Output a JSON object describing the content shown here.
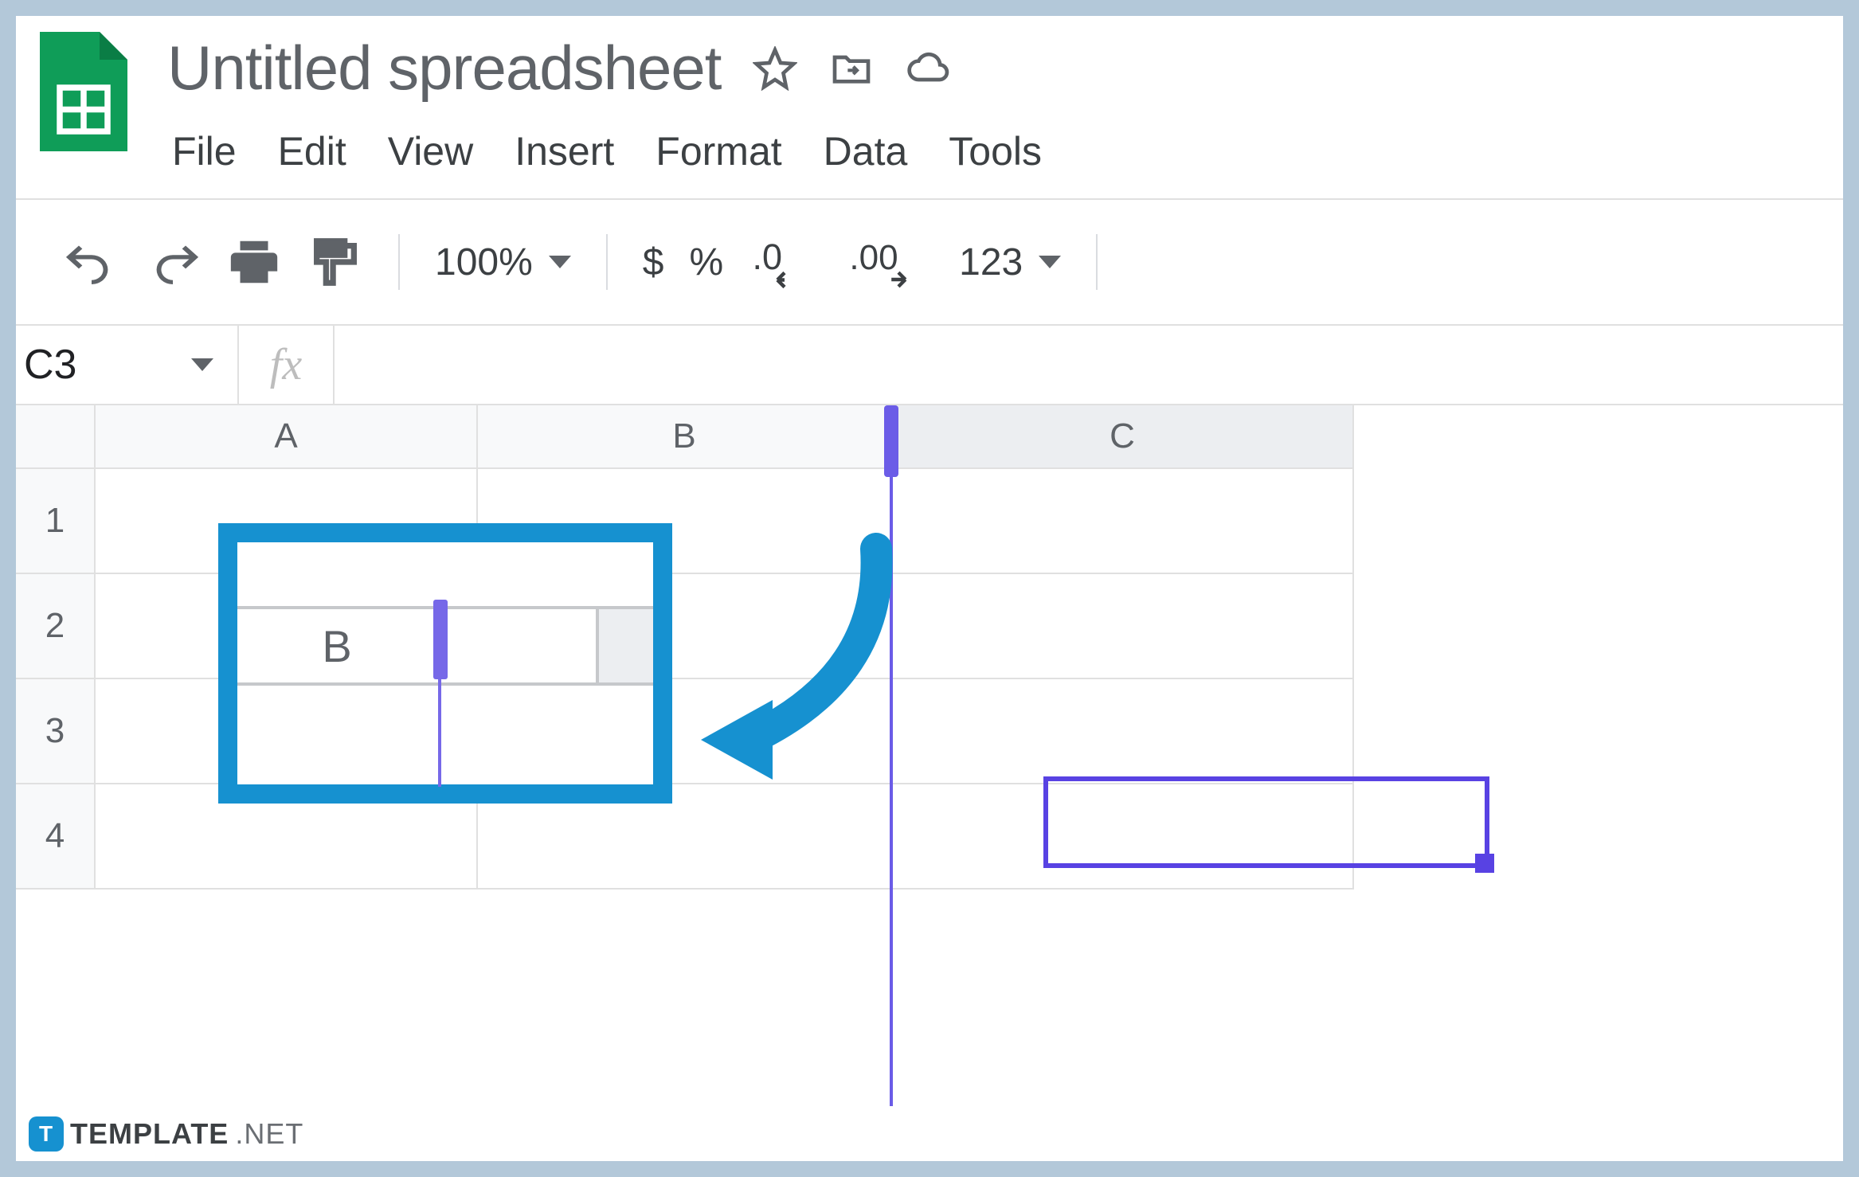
{
  "doc_title": "Untitled spreadsheet",
  "menubar": {
    "file": "File",
    "edit": "Edit",
    "view": "View",
    "insert": "Insert",
    "format": "Format",
    "data": "Data",
    "tools": "Tools"
  },
  "toolbar": {
    "zoom": "100%",
    "currency": "$",
    "percent": "%",
    "dec_decrease": ".0",
    "dec_increase": ".00",
    "number_format": "123"
  },
  "formula_bar": {
    "name_box": "C3",
    "fx": "fx",
    "value": ""
  },
  "columns": {
    "A": "A",
    "B": "B",
    "C": "C"
  },
  "rows": {
    "1": "1",
    "2": "2",
    "3": "3",
    "4": "4"
  },
  "callout": {
    "col_label": "B"
  },
  "selected_cell": "C3",
  "watermark": {
    "brand": "TEMPLATE",
    "suffix": ".NET",
    "logo_letter": "T"
  }
}
